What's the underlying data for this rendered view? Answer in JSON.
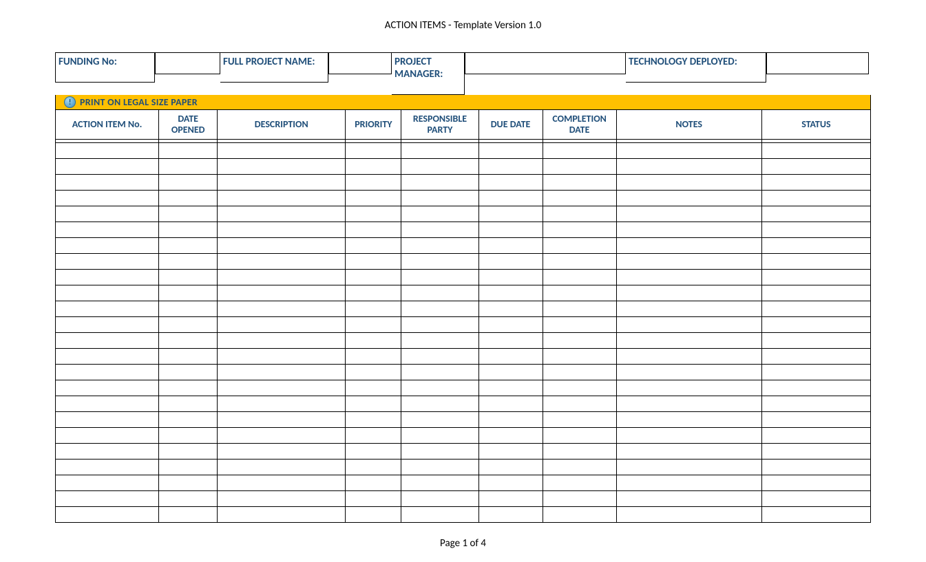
{
  "title": "ACTION ITEMS - Template Version 1.0",
  "info": {
    "funding_no_label": "FUNDING No:",
    "funding_no_value": "",
    "full_project_name_label": "FULL PROJECT NAME:",
    "full_project_name_value": "",
    "project_manager_label": "PROJECT MANAGER:",
    "project_manager_value": "",
    "technology_deployed_label": "TECHNOLOGY DEPLOYED:",
    "technology_deployed_value": ""
  },
  "banner": "PRINT ON LEGAL SIZE PAPER",
  "columns": {
    "c1": "ACTION ITEM No.",
    "c2": "DATE OPENED",
    "c3": "DESCRIPTION",
    "c4": "PRIORITY",
    "c5": "RESPONSIBLE PARTY",
    "c6": "DUE DATE",
    "c7": "COMPLETION DATE",
    "c8": "NOTES",
    "c9": "STATUS"
  },
  "row_count": 24,
  "footer": "Page 1 of 4"
}
